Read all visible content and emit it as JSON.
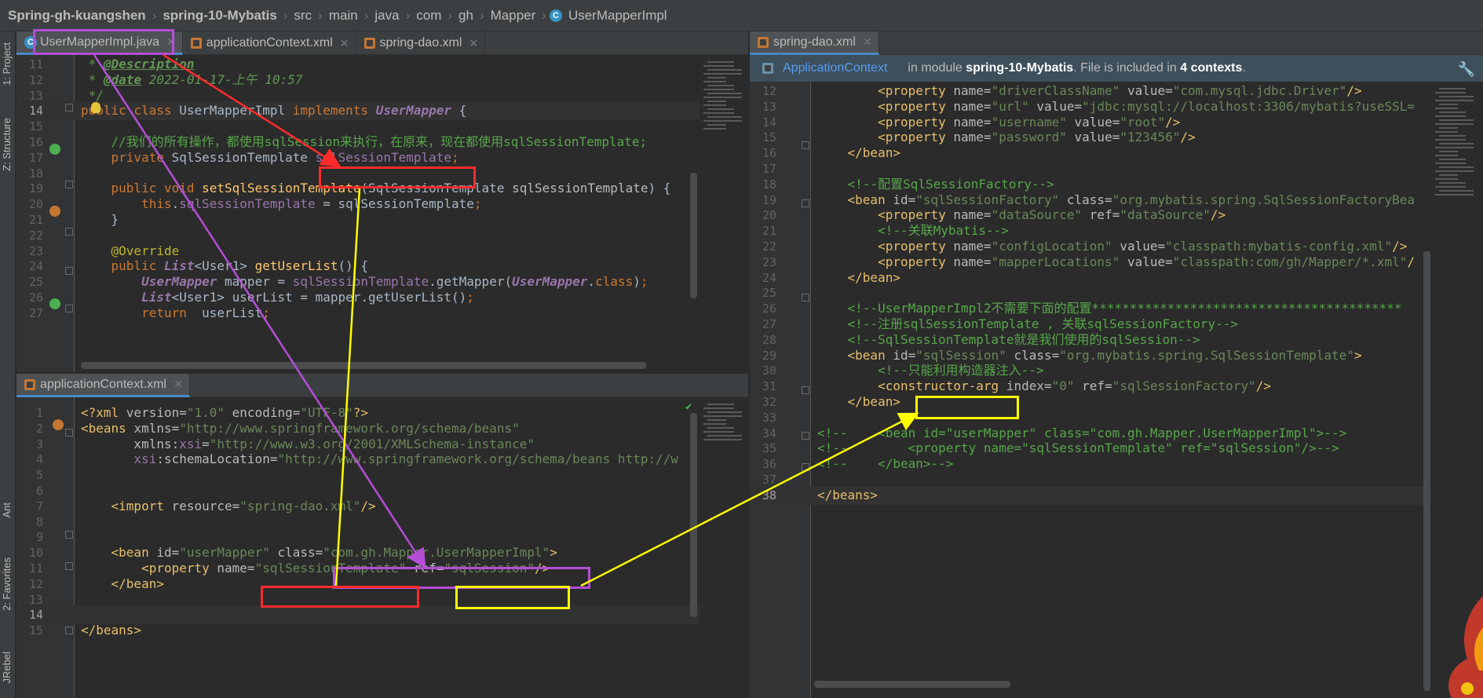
{
  "breadcrumb": {
    "items": [
      "Spring-gh-kuangshen",
      "spring-10-Mybatis",
      "src",
      "main",
      "java",
      "com",
      "gh",
      "Mapper",
      "UserMapperImpl"
    ]
  },
  "tool_windows": {
    "project": "1: Project",
    "structure": "Z: Structure",
    "ant": "Ant",
    "favorites": "2: Favorites",
    "jrebel": "JRebel"
  },
  "pane_java": {
    "tabs": [
      {
        "label": "UserMapperImpl.java",
        "icon": "class-icon",
        "active": true
      },
      {
        "label": "applicationContext.xml",
        "icon": "xml-file-icon",
        "active": false
      },
      {
        "label": "spring-dao.xml",
        "icon": "xml-file-icon",
        "active": false
      }
    ],
    "lines": [
      {
        "n": "11",
        "p": [
          [
            "cm",
            " * "
          ],
          [
            "cm b",
            "@Description"
          ]
        ]
      },
      {
        "n": "12",
        "p": [
          [
            "cm",
            " * "
          ],
          [
            "cm b",
            "@date"
          ],
          [
            "cm",
            " 2022-01-17-上午 10:57"
          ]
        ]
      },
      {
        "n": "13",
        "p": [
          [
            "cm",
            " */"
          ]
        ]
      },
      {
        "n": "14",
        "p": [
          [
            "k",
            "public class "
          ],
          [
            "t",
            "UserMapperImpl "
          ],
          [
            "k",
            "implements "
          ],
          [
            "iface",
            "UserMapper"
          ],
          [
            "t",
            " {"
          ]
        ]
      },
      {
        "n": "15",
        "p": [
          [
            "t",
            ""
          ]
        ]
      },
      {
        "n": "16",
        "p": [
          [
            "cl",
            "    //我们的所有操作，都使用sqlSession来执行，在原来，现在都使用sqlSessionTemplate;"
          ]
        ]
      },
      {
        "n": "17",
        "p": [
          [
            "k",
            "    private "
          ],
          [
            "t",
            "SqlSessionTemplate "
          ],
          [
            "fld",
            "sqlSessionTemplate"
          ],
          [
            "k",
            ";"
          ]
        ]
      },
      {
        "n": "18",
        "p": [
          [
            "t",
            ""
          ]
        ]
      },
      {
        "n": "19",
        "p": [
          [
            "k",
            "    public void "
          ],
          [
            "mth",
            "setSqlSessionTemplate"
          ],
          [
            "t",
            "(SqlSessionTemplate "
          ],
          [
            "a",
            "sqlSessionTemplate"
          ],
          [
            "t",
            ") {"
          ]
        ]
      },
      {
        "n": "20",
        "p": [
          [
            "k",
            "        this"
          ],
          [
            "t",
            "."
          ],
          [
            "fld",
            "sqlSessionTemplate"
          ],
          [
            "t",
            " = sqlSessionTemplate"
          ],
          [
            "k",
            ";"
          ]
        ]
      },
      {
        "n": "21",
        "p": [
          [
            "t",
            "    }"
          ]
        ]
      },
      {
        "n": "22",
        "p": [
          [
            "t",
            ""
          ]
        ]
      },
      {
        "n": "23",
        "p": [
          [
            "an",
            "    @Override"
          ]
        ]
      },
      {
        "n": "24",
        "p": [
          [
            "k",
            "    public "
          ],
          [
            "iface",
            "List"
          ],
          [
            "t",
            "<User1> "
          ],
          [
            "mth",
            "getUserList"
          ],
          [
            "t",
            "() {"
          ]
        ]
      },
      {
        "n": "25",
        "p": [
          [
            "iface",
            "        UserMapper "
          ],
          [
            "t",
            "mapper = "
          ],
          [
            "fld",
            "sqlSessionTemplate"
          ],
          [
            "t",
            ".getMapper("
          ],
          [
            "iface",
            "UserMapper"
          ],
          [
            "t",
            "."
          ],
          [
            "k",
            "class"
          ],
          [
            "t",
            ")"
          ],
          [
            "k",
            ";"
          ]
        ]
      },
      {
        "n": "26",
        "p": [
          [
            "iface",
            "        List"
          ],
          [
            "t",
            "<User1> userList = mapper.getUserList()"
          ],
          [
            "k",
            ";"
          ]
        ]
      },
      {
        "n": "27",
        "p": [
          [
            "k",
            "        return "
          ],
          [
            "t",
            " userList"
          ],
          [
            "k",
            ";"
          ]
        ]
      }
    ]
  },
  "pane_ctx": {
    "tabs": [
      {
        "label": "applicationContext.xml",
        "icon": "xml-file-icon",
        "active": true
      }
    ],
    "lines": [
      {
        "n": "1",
        "p": [
          [
            "tag",
            "<?xml "
          ],
          [
            "a",
            "version="
          ],
          [
            "s",
            "\"1.0\" "
          ],
          [
            "a",
            "encoding="
          ],
          [
            "s",
            "\"UTF-8\""
          ],
          [
            "tag",
            "?>"
          ]
        ]
      },
      {
        "n": "2",
        "p": [
          [
            "tag",
            "<beans "
          ],
          [
            "a",
            "xmlns="
          ],
          [
            "s",
            "\"http://www.springframework.org/schema/beans\""
          ]
        ]
      },
      {
        "n": "3",
        "p": [
          [
            "a",
            "       xmlns:"
          ],
          [
            "it",
            "xsi"
          ],
          [
            "a",
            "="
          ],
          [
            "s",
            "\"http://www.w3.org/2001/XMLSchema-instance\""
          ]
        ]
      },
      {
        "n": "4",
        "p": [
          [
            "it",
            "       xsi"
          ],
          [
            "a",
            ":schemaLocation="
          ],
          [
            "s",
            "\"http://www.springframework.org/schema/beans http://w"
          ]
        ]
      },
      {
        "n": "5",
        "p": [
          [
            "t",
            ""
          ]
        ]
      },
      {
        "n": "6",
        "p": [
          [
            "t",
            ""
          ]
        ]
      },
      {
        "n": "7",
        "p": [
          [
            "tag",
            "    <import "
          ],
          [
            "a",
            "resource="
          ],
          [
            "s",
            "\"spring-dao.xml\""
          ],
          [
            "tag",
            "/>"
          ]
        ]
      },
      {
        "n": "8",
        "p": [
          [
            "t",
            ""
          ]
        ]
      },
      {
        "n": "9",
        "p": [
          [
            "t",
            ""
          ]
        ]
      },
      {
        "n": "10",
        "p": [
          [
            "tag",
            "    <bean "
          ],
          [
            "a",
            "id="
          ],
          [
            "s",
            "\"userMapper\" "
          ],
          [
            "a",
            "class="
          ],
          [
            "s",
            "\"com.gh.Mapper.UserMapperImpl\""
          ],
          [
            "tag",
            ">"
          ]
        ]
      },
      {
        "n": "11",
        "p": [
          [
            "tag",
            "        <property "
          ],
          [
            "a",
            "name="
          ],
          [
            "s",
            "\"sqlSessionTemplate\" "
          ],
          [
            "a",
            "ref="
          ],
          [
            "s",
            "\"sqlSession\""
          ],
          [
            "tag",
            "/>"
          ]
        ]
      },
      {
        "n": "12",
        "p": [
          [
            "tag",
            "    </bean>"
          ]
        ]
      },
      {
        "n": "13",
        "p": [
          [
            "t",
            ""
          ]
        ]
      },
      {
        "n": "14",
        "p": [
          [
            "t",
            ""
          ]
        ]
      },
      {
        "n": "15",
        "p": [
          [
            "tag",
            "</beans>"
          ]
        ]
      }
    ]
  },
  "pane_dao": {
    "tabs": [
      {
        "label": "spring-dao.xml",
        "icon": "xml-file-icon",
        "active": true
      }
    ],
    "banner": {
      "context_link": "ApplicationContext",
      "text_in_module": "in module",
      "module": "spring-10-Mybatis",
      "text_included": ". File is included in",
      "count": "4 contexts",
      "text_end": "."
    },
    "lines": [
      {
        "n": "12",
        "p": [
          [
            "tag",
            "        <property "
          ],
          [
            "a",
            "name="
          ],
          [
            "s",
            "\"driverClassName\" "
          ],
          [
            "a",
            "value="
          ],
          [
            "s",
            "\"com.mysql.jdbc.Driver\""
          ],
          [
            "tag",
            "/>"
          ]
        ]
      },
      {
        "n": "13",
        "p": [
          [
            "tag",
            "        <property "
          ],
          [
            "a",
            "name="
          ],
          [
            "s",
            "\"url\" "
          ],
          [
            "a",
            "value="
          ],
          [
            "s",
            "\"jdbc:mysql://localhost:3306/mybatis?useSSL="
          ]
        ]
      },
      {
        "n": "14",
        "p": [
          [
            "tag",
            "        <property "
          ],
          [
            "a",
            "name="
          ],
          [
            "s",
            "\"username\" "
          ],
          [
            "a",
            "value="
          ],
          [
            "s",
            "\"root\""
          ],
          [
            "tag",
            "/>"
          ]
        ]
      },
      {
        "n": "15",
        "p": [
          [
            "tag",
            "        <property "
          ],
          [
            "a",
            "name="
          ],
          [
            "s",
            "\"password\" "
          ],
          [
            "a",
            "value="
          ],
          [
            "s",
            "\"123456\""
          ],
          [
            "tag",
            "/>"
          ]
        ]
      },
      {
        "n": "16",
        "p": [
          [
            "tag",
            "    </bean>"
          ]
        ]
      },
      {
        "n": "17",
        "p": [
          [
            "t",
            ""
          ]
        ]
      },
      {
        "n": "18",
        "p": [
          [
            "cl",
            "    <!--配置SqlSessionFactory-->"
          ]
        ]
      },
      {
        "n": "19",
        "p": [
          [
            "tag",
            "    <bean "
          ],
          [
            "a",
            "id="
          ],
          [
            "s",
            "\"sqlSessionFactory\" "
          ],
          [
            "a",
            "class="
          ],
          [
            "s",
            "\"org.mybatis.spring.SqlSessionFactoryBea"
          ]
        ]
      },
      {
        "n": "20",
        "p": [
          [
            "tag",
            "        <property "
          ],
          [
            "a",
            "name="
          ],
          [
            "s",
            "\"dataSource\" "
          ],
          [
            "a",
            "ref="
          ],
          [
            "s",
            "\"dataSource\""
          ],
          [
            "tag",
            "/>"
          ]
        ]
      },
      {
        "n": "21",
        "p": [
          [
            "cl",
            "        <!--关联Mybatis-->"
          ]
        ]
      },
      {
        "n": "22",
        "p": [
          [
            "tag",
            "        <property "
          ],
          [
            "a",
            "name="
          ],
          [
            "s",
            "\"configLocation\" "
          ],
          [
            "a",
            "value="
          ],
          [
            "s",
            "\"classpath:mybatis-config.xml\""
          ],
          [
            "tag",
            "/>"
          ]
        ]
      },
      {
        "n": "23",
        "p": [
          [
            "tag",
            "        <property "
          ],
          [
            "a",
            "name="
          ],
          [
            "s",
            "\"mapperLocations\" "
          ],
          [
            "a",
            "value="
          ],
          [
            "s",
            "\"classpath:com/gh/Mapper/*.xml\""
          ],
          [
            "tag",
            "/"
          ]
        ]
      },
      {
        "n": "24",
        "p": [
          [
            "tag",
            "    </bean>"
          ]
        ]
      },
      {
        "n": "25",
        "p": [
          [
            "t",
            ""
          ]
        ]
      },
      {
        "n": "26",
        "p": [
          [
            "cl",
            "    <!--UserMapperImpl2不需要下面的配置*****************************************"
          ]
        ]
      },
      {
        "n": "27",
        "p": [
          [
            "cl",
            "    <!--注册sqlSessionTemplate , 关联sqlSessionFactory-->"
          ]
        ]
      },
      {
        "n": "28",
        "p": [
          [
            "cl",
            "    <!--SqlSessionTemplate就是我们使用的sqlSession-->"
          ]
        ]
      },
      {
        "n": "29",
        "p": [
          [
            "tag",
            "    <bean "
          ],
          [
            "a",
            "id="
          ],
          [
            "s",
            "\"sqlSession\" "
          ],
          [
            "a",
            "class="
          ],
          [
            "s",
            "\"org.mybatis.spring.SqlSessionTemplate\""
          ],
          [
            "tag",
            ">"
          ]
        ]
      },
      {
        "n": "30",
        "p": [
          [
            "cl",
            "        <!--只能利用构造器注入-->"
          ]
        ]
      },
      {
        "n": "31",
        "p": [
          [
            "tag",
            "        <constructor-arg "
          ],
          [
            "a",
            "index="
          ],
          [
            "s",
            "\"0\" "
          ],
          [
            "a",
            "ref="
          ],
          [
            "s",
            "\"sqlSessionFactory\""
          ],
          [
            "tag",
            "/>"
          ]
        ]
      },
      {
        "n": "32",
        "p": [
          [
            "tag",
            "    </bean>"
          ]
        ]
      },
      {
        "n": "33",
        "p": [
          [
            "t",
            ""
          ]
        ]
      },
      {
        "n": "34",
        "p": [
          [
            "cl",
            "<!--    <bean id=\"userMapper\" class=\"com.gh.Mapper.UserMapperImpl\">-->"
          ]
        ]
      },
      {
        "n": "35",
        "p": [
          [
            "cl",
            "<!--        <property name=\"sqlSessionTemplate\" ref=\"sqlSession\"/>-->"
          ]
        ]
      },
      {
        "n": "36",
        "p": [
          [
            "cl",
            "<!--    </bean>-->"
          ]
        ]
      },
      {
        "n": "37",
        "p": [
          [
            "t",
            ""
          ]
        ]
      },
      {
        "n": "38",
        "p": [
          [
            "tag",
            "</beans>"
          ]
        ]
      }
    ]
  },
  "annotation_colors": {
    "red": "#ff2b2b",
    "yellow": "#ffff00",
    "purple": "#b44ed6"
  }
}
